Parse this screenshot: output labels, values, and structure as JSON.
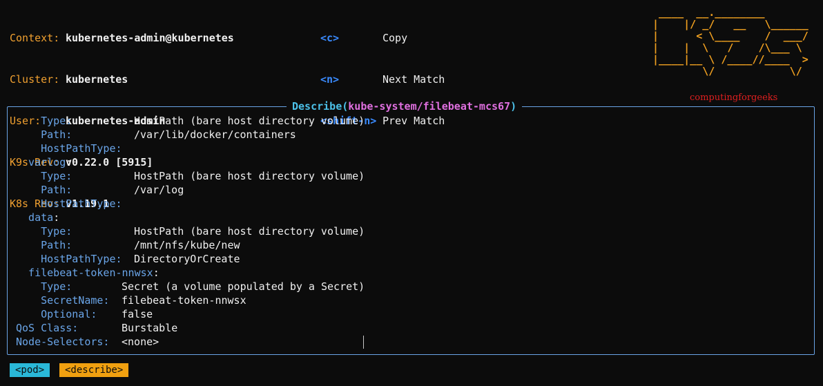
{
  "header": {
    "info": [
      {
        "key": "Context:",
        "value": "kubernetes-admin@kubernetes"
      },
      {
        "key": "Cluster:",
        "value": "kubernetes"
      },
      {
        "key": "User:",
        "value": "kubernetes-admin"
      },
      {
        "key": "K9s Rev:",
        "value": "v0.22.0 [5915]"
      },
      {
        "key": "K8s Rev:",
        "value": "v1.19.1"
      }
    ],
    "hints": [
      {
        "key": "<c>",
        "label": "Copy"
      },
      {
        "key": "<n>",
        "label": "Next Match"
      },
      {
        "key": "<shift-n>",
        "label": "Prev Match"
      }
    ],
    "logo_lines": [
      " ____  __.________        ",
      "|    |/ _/   __   \\______ ",
      "|      < \\____    /  ___/ ",
      "|    |  \\   /    /\\___ \\  ",
      "|____|__ \\ /____//____  > ",
      "        \\/            \\/  "
    ],
    "brand": "computingforgeeks"
  },
  "describe": {
    "title_prefix": "Describe",
    "open_paren": "(",
    "resource": "kube-system/filebeat-mcs67",
    "close_paren": ")",
    "lines": [
      {
        "label": "    Type:",
        "value": "HostPath (bare host directory volume)"
      },
      {
        "label": "    Path:",
        "value": "/var/lib/docker/containers"
      },
      {
        "label": "    HostPathType:",
        "value": ""
      },
      {
        "label": "  varlog",
        "value": ":"
      },
      {
        "label": "    Type:",
        "value": "HostPath (bare host directory volume)"
      },
      {
        "label": "    Path:",
        "value": "/var/log"
      },
      {
        "label": "    HostPathType:",
        "value": ""
      },
      {
        "label": "  data",
        "value": ":"
      },
      {
        "label": "    Type:",
        "value": "HostPath (bare host directory volume)"
      },
      {
        "label": "    Path:",
        "value": "/mnt/nfs/kube/new"
      },
      {
        "label": "    HostPathType:",
        "value": "DirectoryOrCreate"
      },
      {
        "label": "  filebeat-token-nnwsx",
        "value": ":"
      },
      {
        "label": "    Type:",
        "value": "Secret (a volume populated by a Secret)"
      },
      {
        "label": "    SecretName:",
        "value": "filebeat-token-nnwsx"
      },
      {
        "label": "    Optional:",
        "value": "false"
      },
      {
        "label": "QoS Class:",
        "value": "Burstable"
      },
      {
        "label": "Node-Selectors:",
        "value": "<none>"
      }
    ]
  },
  "crumbs": [
    {
      "label": "<pod>",
      "color": "#2ab8d8"
    },
    {
      "label": "<describe>",
      "color": "#f0a010"
    }
  ]
}
